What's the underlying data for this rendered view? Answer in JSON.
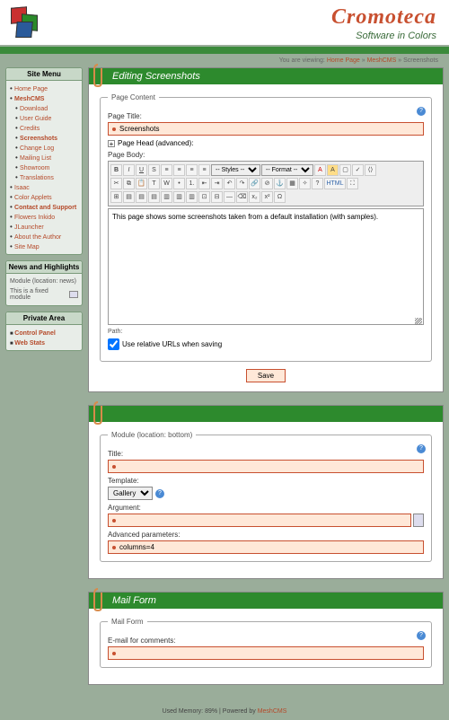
{
  "header": {
    "brand": "Cromoteca",
    "tagline": "Software in Colors"
  },
  "breadcrumb": {
    "prefix": "You are viewing: ",
    "links": [
      "Home Page",
      "MeshCMS"
    ],
    "current": "Screenshots"
  },
  "sidebar": {
    "menu_title": "Site Menu",
    "items": [
      {
        "label": "Home Page"
      },
      {
        "label": "MeshCMS",
        "bold": true
      },
      {
        "label": "Download",
        "sub": true
      },
      {
        "label": "User Guide",
        "sub": true
      },
      {
        "label": "Credits",
        "sub": true
      },
      {
        "label": "Screenshots",
        "sub": true,
        "bold": true
      },
      {
        "label": "Change Log",
        "sub": true
      },
      {
        "label": "Mailing List",
        "sub": true
      },
      {
        "label": "Showroom",
        "sub": true
      },
      {
        "label": "Translations",
        "sub": true
      },
      {
        "label": "Isaac"
      },
      {
        "label": "Color Applets"
      },
      {
        "label": "Contact and Support",
        "bold": true
      },
      {
        "label": "Flowers Inkido"
      },
      {
        "label": "JLauncher"
      },
      {
        "label": "About the Author"
      },
      {
        "label": "Site Map"
      }
    ],
    "news_title": "News and Highlights",
    "news_mod": "Module (location: news)",
    "news_text": "This is a fixed module",
    "private_title": "Private Area",
    "private_items": [
      {
        "label": "Control Panel"
      },
      {
        "label": "Web Stats"
      }
    ]
  },
  "editor": {
    "title": "Editing Screenshots",
    "legend": "Page Content",
    "page_title_label": "Page Title:",
    "page_title_value": "Screenshots",
    "page_head_label": "Page Head (advanced):",
    "page_body_label": "Page Body:",
    "styles_label": "-- Styles --",
    "format_label": "-- Format --",
    "body_text": "This page shows some screenshots taken from a default installation (with samples).",
    "path_label": "Path:",
    "relative_label": "Use relative URLs when saving",
    "save_label": "Save"
  },
  "module": {
    "legend": "Module (location: bottom)",
    "title_label": "Title:",
    "title_value": "",
    "template_label": "Template:",
    "template_value": "Gallery",
    "argument_label": "Argument:",
    "argument_value": "",
    "adv_label": "Advanced parameters:",
    "adv_value": "columns=4"
  },
  "mail": {
    "title": "Mail Form",
    "legend": "Mail Form",
    "email_label": "E-mail for comments:",
    "email_value": ""
  },
  "footer": {
    "text": "Used Memory: 89% | Powered by ",
    "link": "MeshCMS"
  }
}
